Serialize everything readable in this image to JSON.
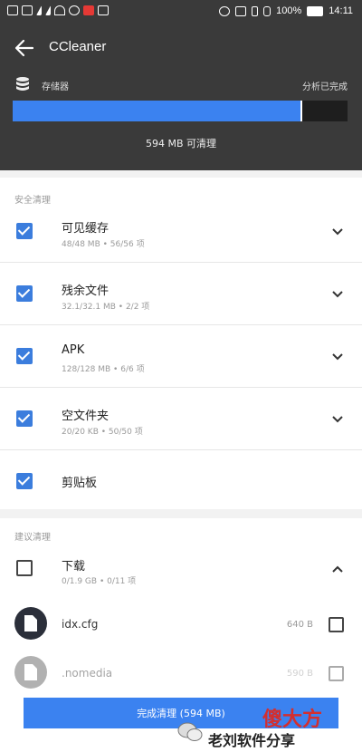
{
  "status_bar": {
    "battery": "100%",
    "time": "14:11",
    "left_icons": [
      "notification-icon",
      "sim-icon",
      "signal-icon",
      "signal-icon",
      "wifi-icon",
      "app-icon",
      "app-icon",
      "app-icon"
    ],
    "right_icons": [
      "alarm-icon",
      "nfc-icon",
      "vibrate-icon",
      "bluetooth-icon"
    ]
  },
  "app_bar": {
    "title": "CCleaner"
  },
  "storage": {
    "label": "存储器",
    "right_text": "分析已完成",
    "used_fraction": 0.86,
    "freed_text": "594 MB 可清理"
  },
  "sections": [
    {
      "title": "安全清理",
      "items": [
        {
          "title": "可见缓存",
          "subtitle": "48/48 MB • 56/56 项",
          "checked": true,
          "expandable": true
        },
        {
          "title": "残余文件",
          "subtitle": "32.1/32.1 MB • 2/2 项",
          "checked": true,
          "expandable": true
        },
        {
          "title": "APK",
          "subtitle": "128/128 MB • 6/6 项",
          "checked": true,
          "expandable": true
        },
        {
          "title": "空文件夹",
          "subtitle": "20/20 KB • 50/50 项",
          "checked": true,
          "expandable": true
        },
        {
          "title": "剪贴板",
          "subtitle": "",
          "checked": true,
          "expandable": false
        }
      ]
    },
    {
      "title": "建议清理",
      "items": [
        {
          "title": "下载",
          "subtitle": "0/1.9 GB • 0/11 项",
          "checked": false,
          "expanded": true
        }
      ],
      "files": [
        {
          "name": "idx.cfg",
          "size": "640 B",
          "checked": false
        },
        {
          "name": ".nomedia",
          "size": "590 B",
          "checked": false
        }
      ]
    }
  ],
  "clean_button": {
    "label": "完成清理 (594 MB)"
  },
  "watermark": {
    "line1": "傻大方",
    "line2": "老刘软件分享"
  },
  "colors": {
    "accent": "#3b82f0",
    "header": "#3a3a3a",
    "checkbox": "#3b7ddd"
  }
}
